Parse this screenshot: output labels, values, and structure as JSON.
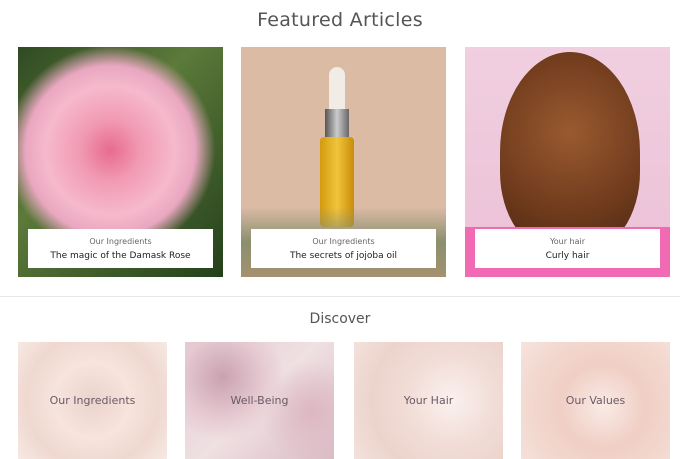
{
  "featured": {
    "title": "Featured Articles",
    "articles": [
      {
        "category": "Our Ingredients",
        "title": "The magic of the Damask Rose"
      },
      {
        "category": "Our Ingredients",
        "title": "The secrets of jojoba oil"
      },
      {
        "category": "Your hair",
        "title": "Curly hair"
      }
    ]
  },
  "discover": {
    "title": "Discover",
    "tiles": [
      {
        "label": "Our Ingredients"
      },
      {
        "label": "Well-Being"
      },
      {
        "label": "Your Hair"
      },
      {
        "label": "Our Values"
      }
    ]
  }
}
